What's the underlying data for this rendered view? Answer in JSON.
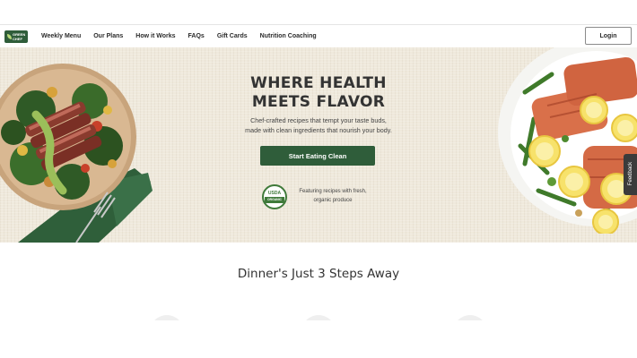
{
  "nav": {
    "logo_text": "GREEN CHEF",
    "links": [
      "Weekly Menu",
      "Our Plans",
      "How it Works",
      "FAQs",
      "Gift Cards",
      "Nutrition Coaching"
    ],
    "login_label": "Login"
  },
  "hero": {
    "title_line1": "WHERE HEALTH",
    "title_line2": "MEETS FLAVOR",
    "subtitle_line1": "Chef-crafted recipes that tempt your taste buds,",
    "subtitle_line2": "made with clean ingredients that nourish your body.",
    "cta_label": "Start Eating Clean",
    "usda_top": "USDA",
    "usda_band": "ORGANIC",
    "organic_line1": "Featuring recipes with fresh,",
    "organic_line2": "organic produce"
  },
  "feedback_label": "Feedback",
  "steps": {
    "title": "Dinner's Just 3 Steps Away"
  },
  "colors": {
    "brand_green": "#2f5d3a",
    "hero_bg": "#efe9dc"
  }
}
